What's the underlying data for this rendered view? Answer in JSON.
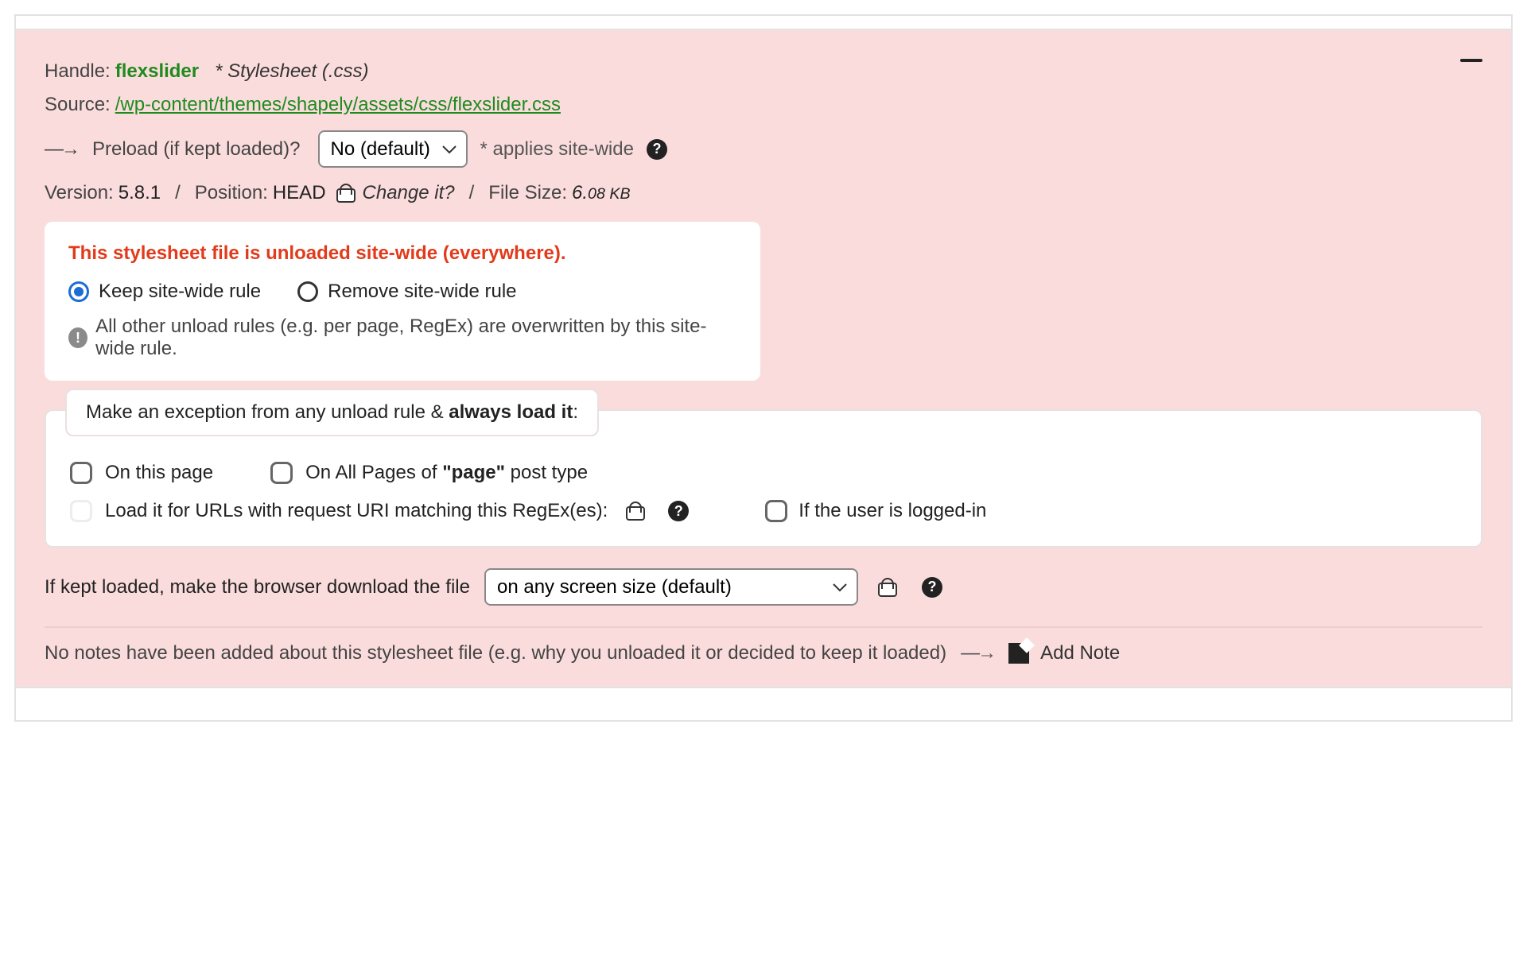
{
  "header": {
    "handle_label": "Handle:",
    "handle_value": "flexslider",
    "asset_type": "* Stylesheet (.css)",
    "source_label": "Source:",
    "source_path": "/wp-content/themes/shapely/assets/css/flexslider.css"
  },
  "preload": {
    "label": "Preload (if kept loaded)?",
    "selected": "No (default)",
    "applies": "* applies site-wide"
  },
  "meta": {
    "version_label": "Version:",
    "version_value": "5.8.1",
    "position_label": "Position:",
    "position_value": "HEAD",
    "change_it": "Change it?",
    "filesize_label": "File Size:",
    "filesize_whole": "6.",
    "filesize_frac": "08 KB"
  },
  "sitewide": {
    "title": "This stylesheet file is unloaded site-wide (everywhere).",
    "keep_label": "Keep site-wide rule",
    "remove_label": "Remove site-wide rule",
    "info": "All other unload rules (e.g. per page, RegEx) are overwritten by this site-wide rule."
  },
  "exception": {
    "legend_prefix": "Make an exception from any unload rule & ",
    "legend_strong": "always load it",
    "legend_suffix": ":",
    "on_this_page": "On this page",
    "on_all_pages_prefix": "On All Pages of ",
    "on_all_pages_strong": "\"page\"",
    "on_all_pages_suffix": " post type",
    "regex_label": "Load it for URLs with request URI matching this RegEx(es):",
    "logged_in": "If the user is logged-in"
  },
  "screen": {
    "label": "If kept loaded, make the browser download the file",
    "selected": "on any screen size (default)"
  },
  "footer": {
    "no_notes": "No notes have been added about this stylesheet file (e.g. why you unloaded it or decided to keep it loaded)",
    "add_note": "Add Note"
  }
}
